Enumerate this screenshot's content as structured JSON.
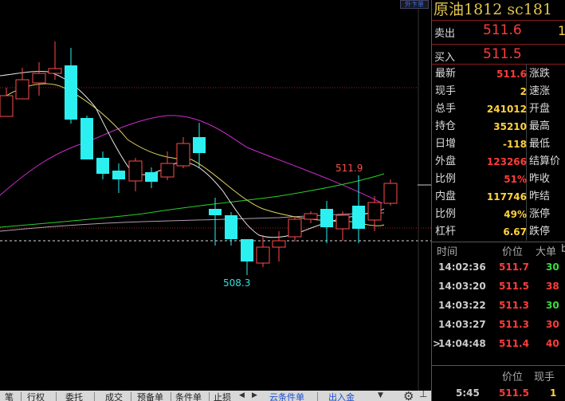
{
  "top_button": "外卞单",
  "chart": {
    "high_label": "511.9",
    "low_label": "508.3"
  },
  "quote": {
    "title": "原油1812  sc181",
    "sell_label": "卖出",
    "sell_price": "511.6",
    "sell_size": "1",
    "buy_label": "买入",
    "buy_price": "511.5",
    "stats": [
      {
        "left": "最新",
        "value": "511.6",
        "color": "#ff3c3c",
        "right": "涨跌"
      },
      {
        "left": "现手",
        "value": "2",
        "color": "#ffd23c",
        "right": "速涨"
      },
      {
        "left": "总手",
        "value": "241012",
        "color": "#ffd23c",
        "right": "开盘"
      },
      {
        "left": "持仓",
        "value": "35210",
        "color": "#ffd23c",
        "right": "最高"
      },
      {
        "left": "日增",
        "value": "-118",
        "color": "#ffd23c",
        "right": "最低"
      },
      {
        "left": "外盘",
        "value": "123266",
        "color": "#ff3c3c",
        "right": "结算价"
      },
      {
        "left": "比例",
        "value": "51%",
        "color": "#ff3c3c",
        "right": "昨收"
      },
      {
        "left": "内盘",
        "value": "117746",
        "color": "#ffd23c",
        "right": "昨结"
      },
      {
        "left": "比例",
        "value": "49%",
        "color": "#ffd23c",
        "right": "涨停"
      },
      {
        "left": "杠杆",
        "value": "6.67",
        "color": "#ffd23c",
        "right": "跌停"
      }
    ],
    "ticks_header": {
      "time": "时间",
      "price": "价位",
      "big": "大单",
      "extra": "b"
    },
    "ticks": [
      {
        "time": "14:02:36",
        "price": "511.7",
        "qty": "30",
        "color": "#3cdc3c",
        "marker": ""
      },
      {
        "time": "14:03:20",
        "price": "511.5",
        "qty": "38",
        "color": "#ff3c3c",
        "marker": ""
      },
      {
        "time": "14:03:22",
        "price": "511.3",
        "qty": "30",
        "color": "#3cdc3c",
        "marker": ""
      },
      {
        "time": "14:03:27",
        "price": "511.3",
        "qty": "30",
        "color": "#ff3c3c",
        "marker": ""
      },
      {
        "time": "14:04:48",
        "price": "511.4",
        "qty": "40",
        "color": "#ff3c3c",
        "marker": ">"
      }
    ],
    "bottom_header": {
      "price": "价位",
      "qty": "现手"
    },
    "bottom_row": {
      "time": "5:45",
      "price": "511.5",
      "qty": "1"
    }
  },
  "bottom_tabs": [
    "笔",
    "行权",
    "委托",
    "成交",
    "预备单",
    "条件单",
    "止损",
    "云条件单",
    "出入金"
  ]
}
